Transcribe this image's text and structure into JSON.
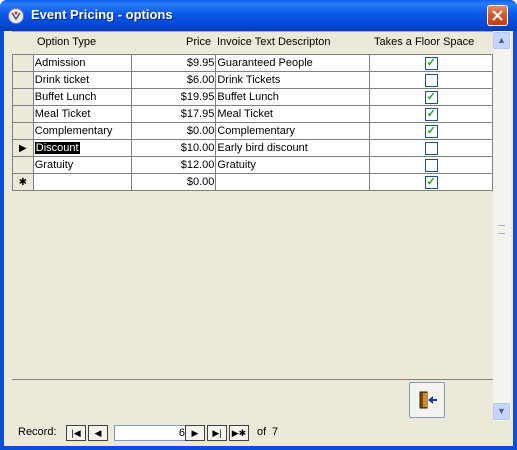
{
  "window": {
    "title": "Event Pricing - options",
    "close_glyph": "✕"
  },
  "columns": {
    "option_type": "Option Type",
    "price": "Price",
    "invoice_text": "Invoice Text Descripton",
    "floor_space": "Takes a Floor Space"
  },
  "rows": [
    {
      "option": "Admission",
      "price": "$9.95",
      "invoice": "Guaranteed People",
      "floor": true,
      "selector": ""
    },
    {
      "option": "Drink ticket",
      "price": "$6.00",
      "invoice": "Drink Tickets",
      "floor": false,
      "selector": ""
    },
    {
      "option": "Buffet Lunch",
      "price": "$19.95",
      "invoice": "Buffet Lunch",
      "floor": true,
      "selector": ""
    },
    {
      "option": "Meal Ticket",
      "price": "$17.95",
      "invoice": "Meal Ticket",
      "floor": true,
      "selector": ""
    },
    {
      "option": "Complementary",
      "price": "$0.00",
      "invoice": "Complementary",
      "floor": true,
      "selector": ""
    },
    {
      "option": "Discount",
      "price": "$10.00",
      "invoice": "Early bird discount",
      "floor": false,
      "selector": "▶"
    },
    {
      "option": "Gratuity",
      "price": "$12.00",
      "invoice": "Gratuity",
      "floor": false,
      "selector": ""
    },
    {
      "option": "",
      "price": "$0.00",
      "invoice": "",
      "floor": true,
      "selector": "✱"
    }
  ],
  "record_nav": {
    "label": "Record:",
    "current": "6",
    "of_label": "of",
    "total": "7",
    "first_glyph": "|◀",
    "prev_glyph": "◀",
    "next_glyph": "▶",
    "last_glyph": "▶|",
    "new_glyph": "▶✱"
  },
  "icons": {
    "title": "access-form-icon",
    "exit": "exit-door-icon"
  },
  "colors": {
    "titlebar": "#0a58e8",
    "close": "#d55a2c",
    "check": "#21a121"
  }
}
